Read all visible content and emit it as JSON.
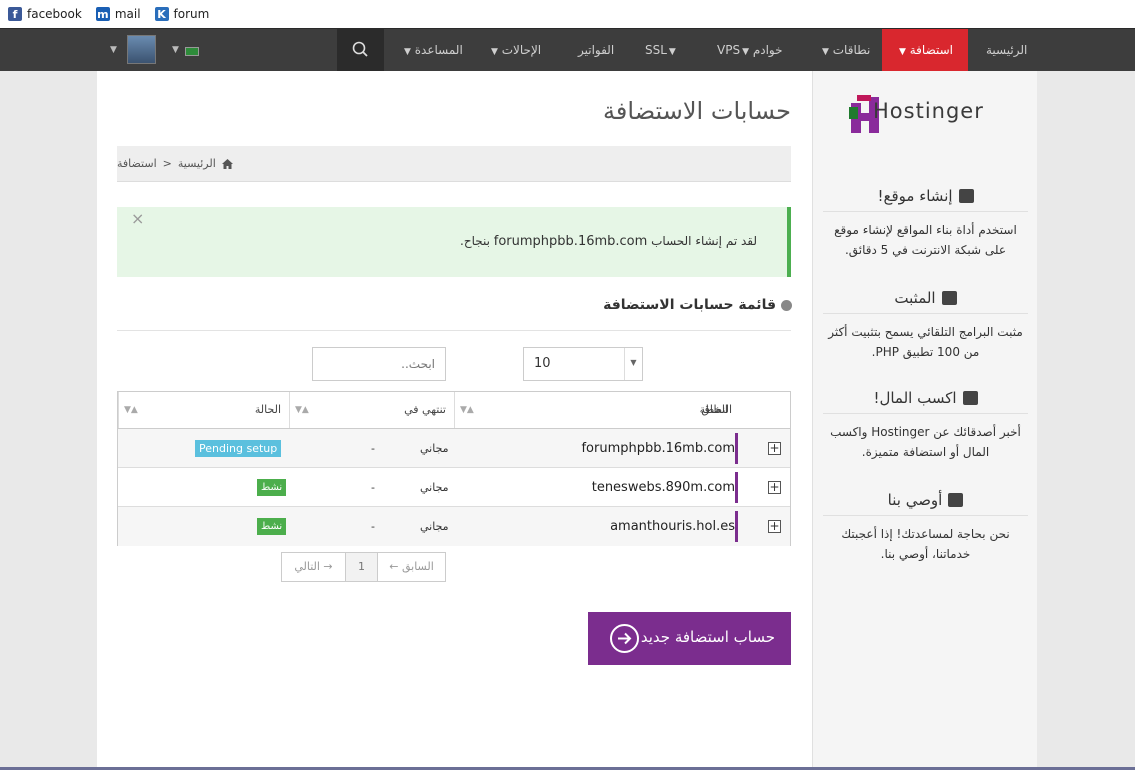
{
  "bookmarks": [
    {
      "label": "facebook",
      "icon": "facebook-icon"
    },
    {
      "label": "mail",
      "icon": "mail-icon"
    },
    {
      "label": "forum",
      "icon": "forum-icon"
    }
  ],
  "nav": {
    "home": "الرئيسية",
    "hosting": "استضافة",
    "domains": "نطاقات",
    "servers": "خوادم",
    "vps": "VPS",
    "ssl": "SSL",
    "billing": "الفواتير",
    "referrals": "الإحالات",
    "help": "المساعدة"
  },
  "page": {
    "title": "حسابات الاستضافة",
    "breadcrumb": {
      "home": "الرئيسية",
      "separator": "<",
      "current": "استضافة"
    }
  },
  "alert": {
    "prefix": "لقد تم إنشاء الحساب",
    "domain": "forumphpbb.16mb.com",
    "suffix": "بنجاح.",
    "close": "×"
  },
  "list": {
    "title": "قائمة حسابات الاستضافة",
    "search_placeholder": "ابحث..",
    "page_size": "10"
  },
  "table": {
    "headers": {
      "domain": "النطاق",
      "plan": "الخطة",
      "expires": "تنتهي في",
      "status": "الحالة"
    },
    "rows": [
      {
        "domain": "forumphpbb.16mb.com",
        "plan": "مجاني",
        "expires": "-",
        "status": "Pending setup"
      },
      {
        "domain": "teneswebs.890m.com",
        "plan": "مجاني",
        "expires": "-",
        "status": "نشط"
      },
      {
        "domain": "amanthouris.hol.es",
        "plan": "مجاني",
        "expires": "-",
        "status": "نشط"
      }
    ]
  },
  "pager": {
    "prev": "← السابق",
    "current": "1",
    "next": "التالي →"
  },
  "new_account_button": "حساب استضافة جديد",
  "sidebar": {
    "logo": "Hostinger",
    "blocks": [
      {
        "title": "إنشاء موقع!",
        "body": "استخدم أداة بناء المواقع لإنشاء موقع على شبكة الانترنت في 5 دقائق.",
        "icon": "gears-icon"
      },
      {
        "title": "المثبت",
        "body": "مثبت البرامج التلقائي يسمح بتثبيت أكثر من 100 تطبيق PHP.",
        "icon": "download-icon"
      },
      {
        "title": "اكسب المال!",
        "body": "أخبر أصدقائك عن Hostinger واكسب المال أو استضافة متميزة.",
        "icon": "money-icon"
      },
      {
        "title": "أوصي بنا",
        "body": "نحن بحاجة لمساعدتك! إذا أعجبتك خدماتنا، أوصي بنا.",
        "icon": "thumbs-up-icon"
      }
    ]
  },
  "colors": {
    "nav_active": "#d9272e",
    "brand_purple": "#7b2d8e",
    "alert_green": "#4caf50",
    "pending_badge": "#5bc0de",
    "active_badge": "#4cae4c"
  }
}
